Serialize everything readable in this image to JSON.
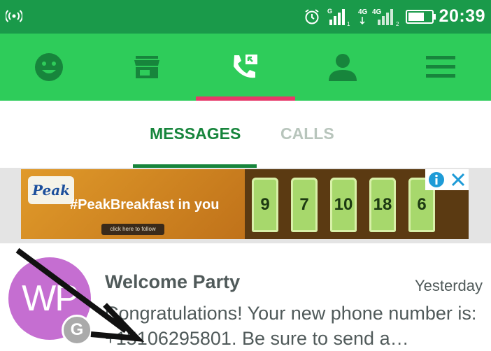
{
  "status_bar": {
    "time": "20:39",
    "network_1": "G",
    "network_2": "4G",
    "network_2b": "4G",
    "sim_1": "1",
    "sim_2": "2",
    "icons": [
      "radio-waves-icon",
      "alarm-icon",
      "signal-icon",
      "battery-icon"
    ]
  },
  "top_tabs": {
    "icons": [
      "emoji-icon",
      "store-icon",
      "phone-message-icon",
      "person-icon",
      "menu-icon"
    ],
    "selected": "phone-message-icon",
    "accent": "#e6396a",
    "background": "#2ecc5a"
  },
  "sub_tabs": {
    "messages_label": "MESSAGES",
    "calls_label": "CALLS",
    "selected": "MESSAGES",
    "accent": "#17853c"
  },
  "ad": {
    "brand": "Peak",
    "hashtag": "#PeakBreakfast in you",
    "cta": "click here to follow",
    "jersey_numbers": [
      "9",
      "7",
      "10",
      "18",
      "6"
    ]
  },
  "conversation": {
    "avatar_initials": "WP",
    "badge_letter": "G",
    "title": "Welcome Party",
    "time": "Yesterday",
    "preview": "Congratulations! Your new phone number is: +15106295801. Be sure to send a…"
  }
}
